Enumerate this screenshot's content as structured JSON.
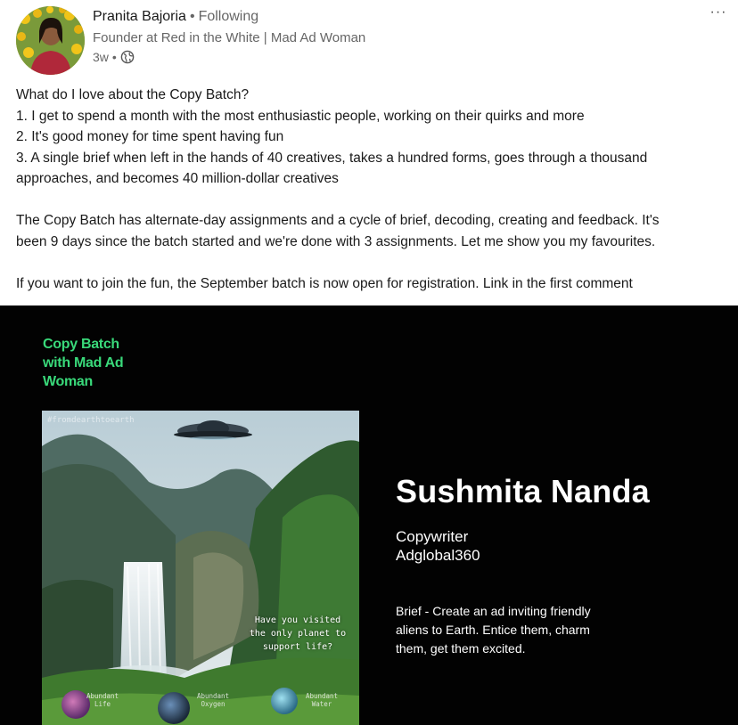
{
  "author": {
    "name": "Pranita Bajoria",
    "separator": "•",
    "follow_status": "Following",
    "headline": "Founder at Red in the White | Mad Ad Woman",
    "time": "3w",
    "time_separator": "•",
    "visibility_icon": "globe-icon"
  },
  "more_menu": {
    "label": "···",
    "icon": "more-options-icon"
  },
  "post": {
    "lines": [
      "What do I love about the Copy Batch?",
      "1. I get to spend a month with the most enthusiastic people, working on their quirks and more",
      "2. It's good money for time spent having fun",
      "3. A single brief when left in the hands of 40 creatives, takes a hundred forms, goes through a thousand",
      "approaches, and becomes 40 million-dollar creatives"
    ],
    "paragraph2_lines": [
      "The Copy Batch has alternate-day assignments and a cycle of brief, decoding, creating and feedback. It's",
      "been 9 days since the batch started and we're done with 3 assignments. Let me show you my favourites."
    ],
    "paragraph3": "If you want to join the fun, the September batch is now open for registration. Link in the first comment"
  },
  "media": {
    "brand_line1": "Copy Batch",
    "brand_line2": "with Mad Ad",
    "brand_line3": "Woman",
    "brand_color": "#39d97a",
    "image": {
      "hashtag": "#fromdearthtoearth",
      "question_line1": "Have you visited",
      "question_line2": "the only planet to",
      "question_line3": "support life?",
      "badge1_line1": "Abundant",
      "badge1_line2": "Life",
      "badge2_line1": "Abundant",
      "badge2_line2": "Oxygen",
      "badge3_line1": "Abundant",
      "badge3_line2": "Water"
    },
    "person_name": "Sushmita Nanda",
    "role": "Copywriter",
    "company": "Adglobal360",
    "brief_line1": "Brief - Create an ad inviting friendly",
    "brief_line2": "aliens to Earth. Entice them, charm",
    "brief_line3": "them, get them excited."
  }
}
